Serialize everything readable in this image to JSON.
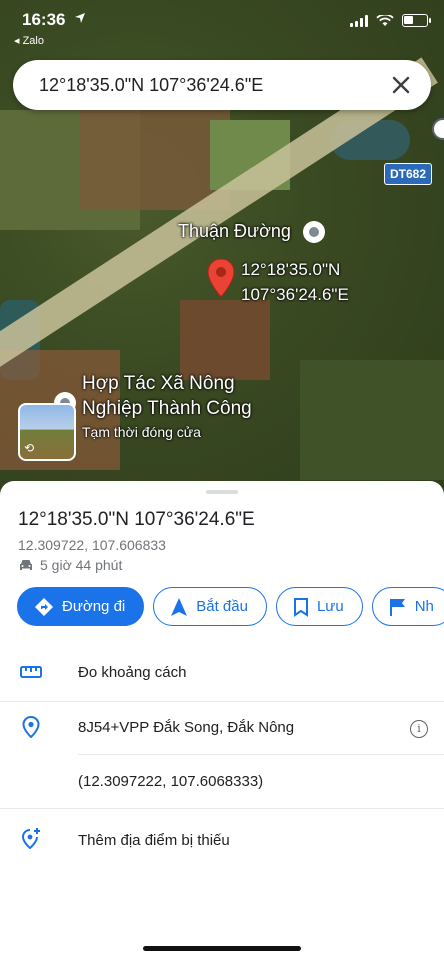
{
  "status_bar": {
    "time": "16:36",
    "back_label": "◂ Zalo"
  },
  "search": {
    "query": "12°18'35.0\"N 107°36'24.6\"E",
    "close_icon": "close-icon"
  },
  "map": {
    "road_label": "DT682",
    "poi_thuan_duong": "Thuận Đường",
    "pin_label_line1": "12°18'35.0\"N",
    "pin_label_line2": "107°36'24.6\"E",
    "poi_htx_line1": "Hợp Tác Xã Nông",
    "poi_htx_line2": "Nghiệp Thành Công",
    "poi_htx_status": "Tạm thời đóng cửa"
  },
  "place": {
    "title": "12°18'35.0\"N 107°36'24.6\"E",
    "decimal_coords": "12.309722, 107.606833",
    "drive_time": "5 giờ 44 phút"
  },
  "actions": {
    "directions": "Đường đi",
    "start": "Bắt đầu",
    "save": "Lưu",
    "label_partial": "Nh"
  },
  "rows": {
    "measure": "Đo khoảng cách",
    "plus_code": "8J54+VPP Đắk Song, Đắk Nông",
    "precise_coords": "(12.3097222, 107.6068333)",
    "add_missing": "Thêm địa điểm bị thiếu"
  },
  "colors": {
    "accent": "#1a73e8",
    "pin": "#ea4335",
    "road_badge": "#2a6ab8"
  }
}
